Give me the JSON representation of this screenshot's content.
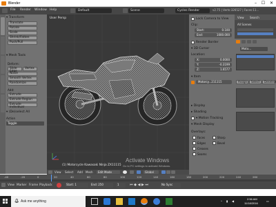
{
  "window": {
    "title": "Blender"
  },
  "info_header": {
    "menus": [
      "File",
      "Render",
      "Window",
      "Help"
    ],
    "layout": "Default",
    "scene": "Scene",
    "engine": "Cycles Render",
    "stats": "v2.75 | Verts:326527 | Faces:11..."
  },
  "tool_shelf": {
    "transform_header": "▾ Transform",
    "transform_tools": [
      "Translate",
      "Rotate",
      "Scale",
      "Shrink/Fatten",
      "Push/Pull"
    ],
    "mesh_tools_header": "▾ Mesh Tools",
    "deform_label": "Deform:",
    "deform_tools": [
      "Slide Edge",
      "Vertex"
    ],
    "deform_tools_full": [
      "Noise",
      "Smooth Vertex",
      "Randomize"
    ],
    "add_label": "Add:",
    "add_tools": [
      "Extrude",
      "Extrude Region",
      "Extrude Individual"
    ],
    "operator_header": "▾ (De)select All",
    "action_label": "Action",
    "action_value": "Toggle"
  },
  "viewport": {
    "view_label": "User Persp",
    "object_label": "(1) Motorcycle Kawasaki Ninja ZX11115"
  },
  "viewport_header": {
    "menus": [
      "View",
      "Select",
      "Add",
      "Mesh"
    ],
    "mode": "Edit Mode",
    "pivot": "Global"
  },
  "n_panel": {
    "lock_label": "Lock Camera to View",
    "clip_label": "Clip:",
    "clip_start_label": "Start:",
    "clip_start_value": "0.100",
    "clip_end_label": "End:",
    "clip_end_value": "1000.000",
    "render_border_label": "Render Border",
    "cursor_header": "▾ 3D Cursor",
    "location_label": "Location:",
    "loc_x_label": "X:",
    "loc_x_value": "0.0000",
    "loc_y_label": "Y:",
    "loc_y_value": "-0.3199",
    "loc_z_label": "Z:",
    "loc_z_value": "1.6577",
    "item_header": "▾ Item",
    "item_name": "Motorcy...211115",
    "display_header": "▸ Display",
    "shading_header": "▸ Shading",
    "motion_header": "▾ Motion Tracking",
    "mesh_display_header": "▾ Mesh Display",
    "overlays_label": "Overlays:",
    "overlays": [
      "Faces",
      "Sharp",
      "Edges",
      "Bevel",
      "Creases",
      "Seams"
    ]
  },
  "outliner": {
    "view_label": "View",
    "search_label": "Search",
    "all_scenes": "All Scenes"
  },
  "properties": {
    "object_field": "Moto...",
    "assign_button": "Assign",
    "select_button": "Select",
    "deselect_button": "Deselect"
  },
  "timeline": {
    "ticks": [
      "-40",
      "-20",
      "0",
      "20",
      "40",
      "60",
      "80",
      "100",
      "120",
      "140",
      "160",
      "180",
      "200",
      "220",
      "240",
      "260"
    ],
    "menus": [
      "View",
      "Marker",
      "Frame",
      "Playback"
    ],
    "start_label": "Start:",
    "start_value": "1",
    "end_label": "End:",
    "end_value": "250",
    "frame_value": "1",
    "sync": "No Sync"
  },
  "watermark": {
    "line1": "Activate Windows",
    "line2": "Go to PC settings to activate Windows."
  },
  "taskbar": {
    "search_placeholder": "Ask me anything",
    "time": "2:56 AM",
    "date": "11/18/2016"
  },
  "colors": {
    "accent_orange": "#e87d0d",
    "viewport_bg": "#393939",
    "panel_bg": "#727272",
    "taskbar_bg": "#202020",
    "selected_blue": "#5680c2"
  }
}
